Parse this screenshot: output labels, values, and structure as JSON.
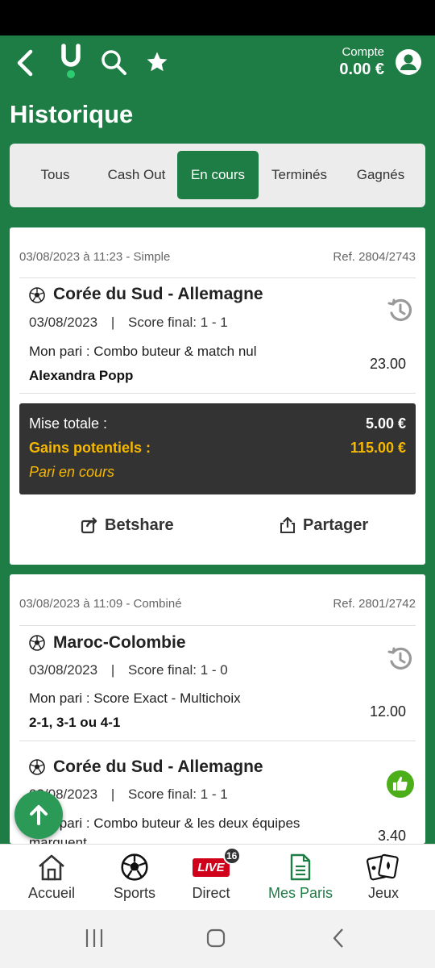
{
  "header": {
    "account_label": "Compte",
    "account_amount": "0.00 €",
    "icons": [
      "back-arrow-icon",
      "unibet-logo-icon",
      "search-icon",
      "star-icon",
      "user-icon"
    ]
  },
  "page": {
    "title": "Historique"
  },
  "filters": {
    "tabs": [
      {
        "label": "Tous"
      },
      {
        "label": "Cash Out"
      },
      {
        "label": "En cours"
      },
      {
        "label": "Terminés"
      },
      {
        "label": "Gagnés"
      }
    ],
    "active": "En cours"
  },
  "bets": [
    {
      "header_left": "03/08/2023 à 11:23 - Simple",
      "header_right": "Ref. 2804/2743",
      "selections": [
        {
          "match": "Corée du Sud - Allemagne",
          "date": "03/08/2023",
          "sep": "|",
          "score": "Score final: 1 - 1",
          "bet_type": "Mon pari : Combo buteur & match nul",
          "selection": "Alexandra Popp",
          "odds": "23.00"
        }
      ],
      "summary": {
        "stake_label": "Mise totale :",
        "stake_value": "5.00 €",
        "gains_label": "Gains potentiels :",
        "gains_value": "115.00 €",
        "status": "Pari en cours"
      },
      "actions": {
        "betshare": "Betshare",
        "share": "Partager"
      }
    },
    {
      "header_left": "03/08/2023 à 11:09 - Combiné",
      "header_right": "Ref. 2801/2742",
      "selections": [
        {
          "match": "Maroc-Colombie",
          "date": "03/08/2023",
          "sep": "|",
          "score": "Score final: 1 - 0",
          "bet_type": "Mon pari : Score Exact - Multichoix",
          "selection": "2-1, 3-1 ou 4-1",
          "odds": "12.00"
        },
        {
          "match": "Corée du Sud - Allemagne",
          "date": "03/08/2023",
          "sep": "|",
          "score": "Score final: 1 - 1",
          "bet_type": "Mon pari : Combo buteur & les deux équipes",
          "bet_type_line2": "marquent",
          "odds": "3.40"
        }
      ]
    }
  ],
  "bottom_nav": {
    "items": [
      {
        "label": "Accueil"
      },
      {
        "label": "Sports"
      },
      {
        "label": "Direct",
        "badge": "LIVE",
        "count": "16"
      },
      {
        "label": "Mes Paris"
      },
      {
        "label": "Jeux"
      }
    ],
    "active": "Mes Paris"
  },
  "colors": {
    "brand": "#1e7d45",
    "gains": "#f5b700",
    "live": "#d0021b",
    "won": "#4caf1a"
  }
}
